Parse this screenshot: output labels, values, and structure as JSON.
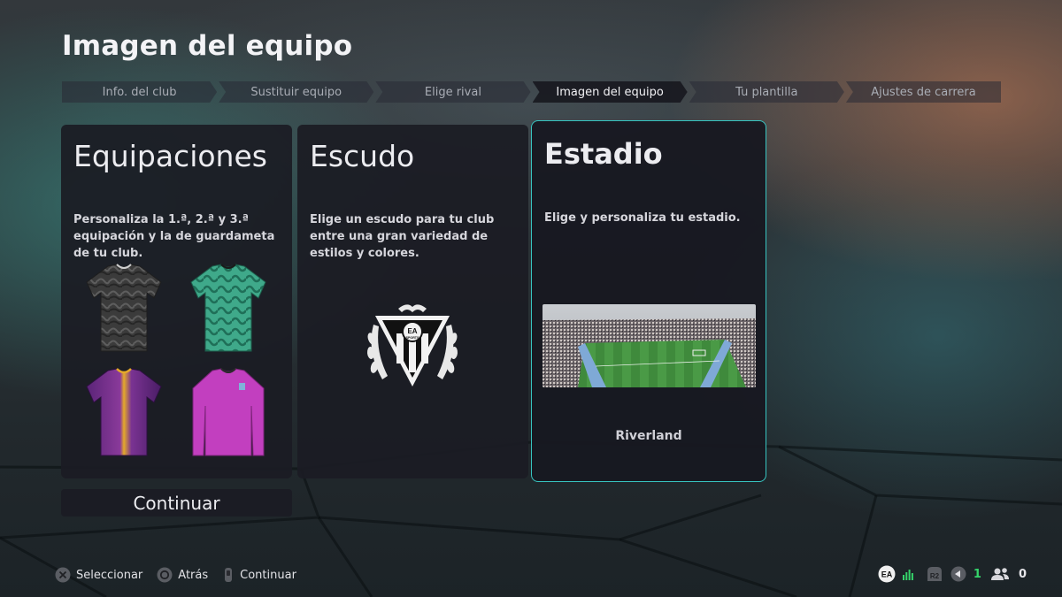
{
  "page": {
    "title": "Imagen del equipo"
  },
  "stepper": {
    "steps": [
      {
        "label": "Info. del club"
      },
      {
        "label": "Sustituir equipo"
      },
      {
        "label": "Elige rival"
      },
      {
        "label": "Imagen del equipo"
      },
      {
        "label": "Tu plantilla"
      },
      {
        "label": "Ajustes de carrera"
      }
    ],
    "active_index": 3
  },
  "cards": {
    "kits": {
      "title": "Equipaciones",
      "description": "Personaliza la 1.ª, 2.ª y 3.ª equipación y la de guardameta de tu club.",
      "items": [
        {
          "name": "home-kit",
          "color": "#3a3a3a"
        },
        {
          "name": "away-kit",
          "color": "#3fa98a"
        },
        {
          "name": "third-kit",
          "color": "#6b2a86"
        },
        {
          "name": "goalkeeper-kit",
          "color": "#c23fbf"
        }
      ]
    },
    "crest": {
      "title": "Escudo",
      "description": "Elige un escudo para tu club entre una gran variedad de estilos y colores.",
      "badge_text": "EA SPORTS"
    },
    "stadium": {
      "title": "Estadio",
      "description": "Elige y personaliza tu estadio.",
      "stadium_name": "Riverland"
    }
  },
  "continue_button": {
    "label": "Continuar"
  },
  "footer": {
    "hints": [
      {
        "icon": "cross-button-icon",
        "label": "Seleccionar"
      },
      {
        "icon": "circle-button-icon",
        "label": "Atrás"
      },
      {
        "icon": "touchpad-button-icon",
        "label": "Continuar"
      }
    ]
  },
  "status": {
    "r2_label": "R2",
    "green_count": "1",
    "friends_count": "0"
  },
  "colors": {
    "accent": "#37c4c0",
    "card_bg": "#1b1c24",
    "online_green": "#35d46a"
  }
}
